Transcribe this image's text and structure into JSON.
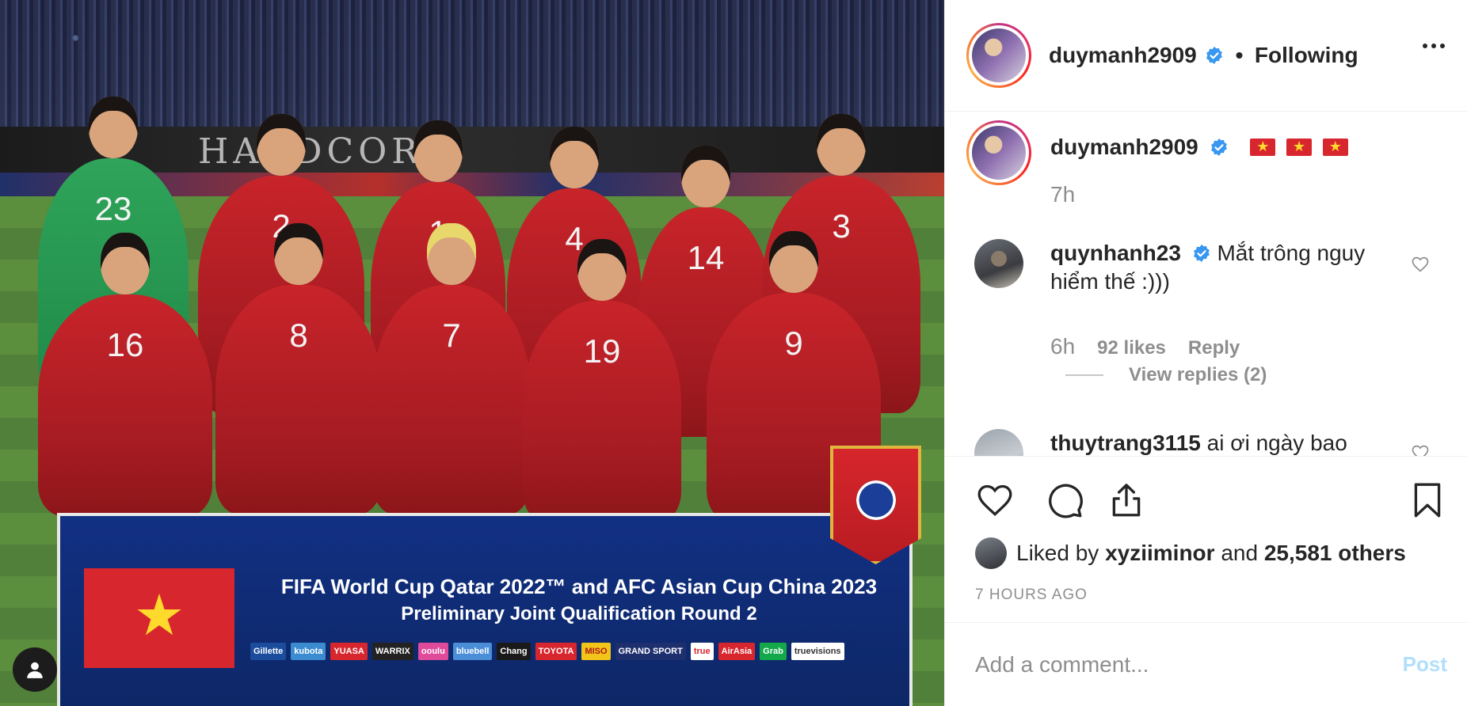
{
  "header": {
    "username": "duymanh2909",
    "separator": "•",
    "follow_status": "Following",
    "more_icon": "more-horizontal-icon"
  },
  "caption": {
    "username": "duymanh2909",
    "flags": [
      "🇻🇳",
      "🇻🇳",
      "🇻🇳"
    ],
    "time": "7h"
  },
  "comments": [
    {
      "username": "quynhanh23",
      "text": "Mắt trông nguy hiểm thế :)))",
      "time": "6h",
      "likes": "92 likes",
      "reply_label": "Reply",
      "view_replies": "View replies (2)"
    },
    {
      "username": "thuytrang3115",
      "text": "ai ơi ngày bao"
    }
  ],
  "actions": {
    "like_icon": "heart-icon",
    "comment_icon": "comment-icon",
    "share_icon": "share-icon",
    "save_icon": "bookmark-icon"
  },
  "likes": {
    "prefix": "Liked by",
    "user": "xyziiminor",
    "and": "and",
    "others": "25,581 others"
  },
  "posted_time": "7 HOURS AGO",
  "comment_input": {
    "placeholder": "Add a comment...",
    "post_label": "Post"
  },
  "photo": {
    "banner_line1": "FIFA World Cup Qatar 2022™ and AFC Asian Cup China 2023",
    "banner_line2": "Preliminary Joint Qualification Round 2",
    "hoarding_text": "HARDCORE",
    "sponsors": [
      "Gillette",
      "kubota",
      "YUASA",
      "WARRIX",
      "ooulu",
      "bluebell",
      "Chang",
      "TOYOTA",
      "MISO",
      "GRAND SPORT",
      "true",
      "AirAsia",
      "Grab",
      "truevisions"
    ],
    "jersey_numbers": [
      "23",
      "2",
      "1",
      "4",
      "14",
      "3",
      "16",
      "8",
      "7",
      "19",
      "9"
    ]
  },
  "colors": {
    "verified_blue": "#3897f0",
    "link_muted": "#b2dffc",
    "muted_text": "#8e8e8e",
    "vn_red": "#d8262e",
    "vn_star": "#ffd92b"
  }
}
